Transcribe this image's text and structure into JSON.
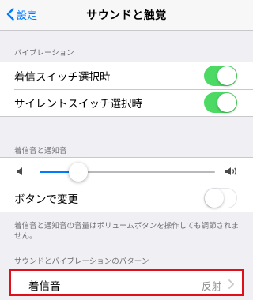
{
  "nav": {
    "back_label": "設定",
    "title": "サウンドと触覚"
  },
  "vibration": {
    "header": "バイブレーション",
    "rows": [
      {
        "label": "着信スイッチ選択時",
        "on": true
      },
      {
        "label": "サイレントスイッチ選択時",
        "on": true
      }
    ]
  },
  "ringer": {
    "header": "着信音と通知音",
    "volume_fraction": 0.22,
    "change_with_buttons_label": "ボタンで変更",
    "change_with_buttons_on": false,
    "footer": "着信音と通知音の音量はボリュームボタンを操作しても調節されません。"
  },
  "patterns": {
    "header": "サウンドとバイブレーションのパターン",
    "ringtone_label": "着信音",
    "ringtone_value": "反射"
  },
  "colors": {
    "accent": "#007aff",
    "toggle_on": "#4cd964",
    "highlight_border": "#e0101a"
  }
}
